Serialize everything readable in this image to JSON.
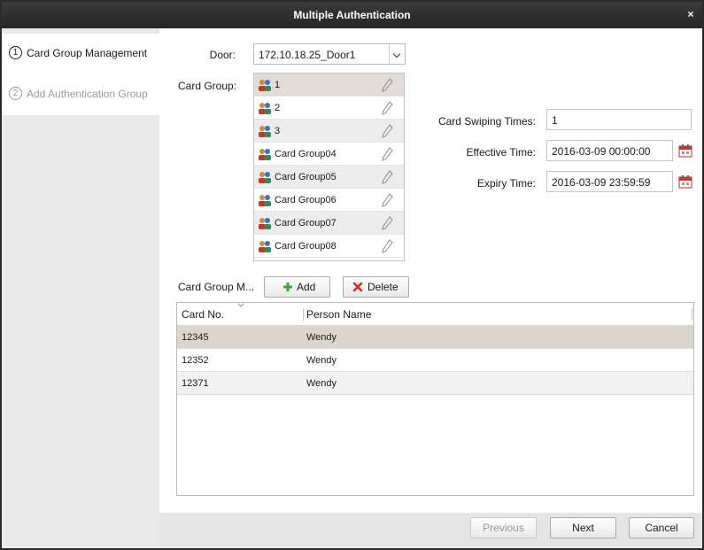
{
  "window": {
    "title": "Multiple Authentication"
  },
  "steps": [
    {
      "num": "1",
      "label": "Card Group Management"
    },
    {
      "num": "2",
      "label": "Add Authentication Group"
    }
  ],
  "door": {
    "label": "Door:",
    "value": "172.10.18.25_Door1"
  },
  "card_group": {
    "label": "Card Group:",
    "items": [
      "1",
      "2",
      "3",
      "Card Group04",
      "Card Group05",
      "Card Group06",
      "Card Group07",
      "Card Group08"
    ]
  },
  "card_swiping": {
    "label": "Card Swiping Times:",
    "value": "1"
  },
  "effective_time": {
    "label": "Effective Time:",
    "value": "2016-03-09 00:00:00"
  },
  "expiry_time": {
    "label": "Expiry Time:",
    "value": "2016-03-09 23:59:59"
  },
  "card_group_members": {
    "label": "Card Group M...",
    "add_label": "Add",
    "delete_label": "Delete",
    "columns": [
      "Card No.",
      "Person Name"
    ],
    "rows": [
      {
        "card_no": "12345",
        "person": "Wendy"
      },
      {
        "card_no": "12352",
        "person": "Wendy"
      },
      {
        "card_no": "12371",
        "person": "Wendy"
      }
    ]
  },
  "footer": {
    "previous": "Previous",
    "next": "Next",
    "cancel": "Cancel"
  },
  "colors": {
    "titlebar": "#2f2f2f",
    "selected_row": "#dcd6d1",
    "add_green": "#3aa63a",
    "delete_red": "#d9261c"
  },
  "icons": [
    "close-icon",
    "dropdown-arrow-icon",
    "card-group-icon",
    "edit-pencil-icon",
    "calendar-icon",
    "add-plus-icon",
    "delete-x-icon",
    "sort-arrow-icon"
  ]
}
